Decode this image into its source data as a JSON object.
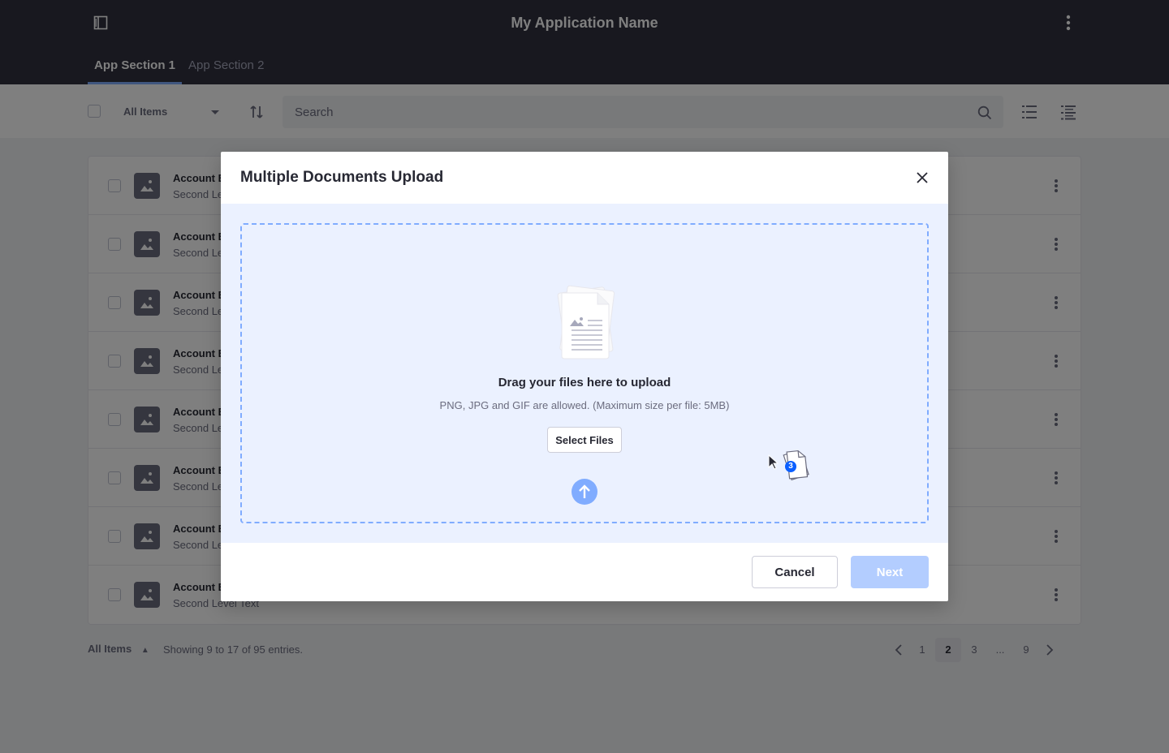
{
  "header": {
    "app_title": "My Application Name",
    "tabs": [
      {
        "label": "App Section 1",
        "active": true
      },
      {
        "label": "App Section 2",
        "active": false
      }
    ]
  },
  "toolbar": {
    "filter_label": "All Items",
    "search_placeholder": "Search"
  },
  "list": {
    "rows": [
      {
        "title": "Account Ex",
        "subtitle": "Second Le"
      },
      {
        "title": "Account Ex",
        "subtitle": "Second Le"
      },
      {
        "title": "Account Ex",
        "subtitle": "Second Le"
      },
      {
        "title": "Account Ex",
        "subtitle": "Second Le"
      },
      {
        "title": "Account Ex",
        "subtitle": "Second Le"
      },
      {
        "title": "Account Ex",
        "subtitle": "Second Le"
      },
      {
        "title": "Account Ex",
        "subtitle": "Second Le"
      },
      {
        "title": "Account Ex",
        "subtitle": "Second Level Text"
      }
    ]
  },
  "footer": {
    "items_label": "All Items",
    "showing_text": "Showing 9 to 17 of 95 entries.",
    "pages": [
      "1",
      "2",
      "3",
      "...",
      "9"
    ],
    "active_page": "2"
  },
  "modal": {
    "title": "Multiple Documents Upload",
    "dropzone_title": "Drag your files here to upload",
    "dropzone_hint": "PNG, JPG and GIF are allowed. (Maximum size per file: 5MB)",
    "select_files_label": "Select Files",
    "dragged_file_count": "3",
    "cancel_label": "Cancel",
    "next_label": "Next"
  },
  "colors": {
    "header_bg": "#30313f",
    "accent": "#80acff",
    "primary_disabled": "#b3cdff",
    "dropzone_bg": "#ebf1ff",
    "badge": "#0b5fff"
  }
}
